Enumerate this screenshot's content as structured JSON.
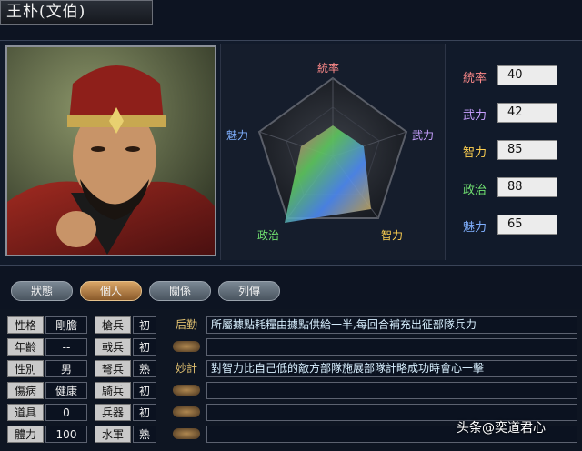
{
  "header": {
    "title": "王朴(文伯)"
  },
  "radar": {
    "labels": {
      "top": "統率",
      "right": "武力",
      "bottom_right": "智力",
      "bottom_left": "政治",
      "left": "魅力"
    },
    "label_colors": {
      "top": "#ff8a8a",
      "right": "#c8a0ff",
      "bottom_right": "#ffd050",
      "bottom_left": "#70e070",
      "left": "#80b0ff"
    }
  },
  "stats": [
    {
      "label": "統率",
      "value": "40",
      "color": "#ff8a8a"
    },
    {
      "label": "武力",
      "value": "42",
      "color": "#c8a0ff"
    },
    {
      "label": "智力",
      "value": "85",
      "color": "#ffd050"
    },
    {
      "label": "政治",
      "value": "88",
      "color": "#70e070"
    },
    {
      "label": "魅力",
      "value": "65",
      "color": "#80b0ff"
    }
  ],
  "tabs": [
    {
      "label": "狀態",
      "active": false
    },
    {
      "label": "個人",
      "active": true
    },
    {
      "label": "關係",
      "active": false
    },
    {
      "label": "列傳",
      "active": false
    }
  ],
  "personal": [
    {
      "label": "性格",
      "value": "剛膽"
    },
    {
      "label": "年齡",
      "value": "--"
    },
    {
      "label": "性別",
      "value": "男"
    },
    {
      "label": "傷病",
      "value": "健康"
    },
    {
      "label": "道具",
      "value": "0"
    },
    {
      "label": "體力",
      "value": "100"
    }
  ],
  "troops": [
    {
      "label": "槍兵",
      "value": "初"
    },
    {
      "label": "戟兵",
      "value": "初"
    },
    {
      "label": "弩兵",
      "value": "熟"
    },
    {
      "label": "騎兵",
      "value": "初"
    },
    {
      "label": "兵器",
      "value": "初"
    },
    {
      "label": "水軍",
      "value": "熟"
    }
  ],
  "skills": [
    {
      "name": "后勤",
      "desc": "所屬據點耗糧由據點供給一半,每回合補充出征部隊兵力"
    },
    {
      "name": "",
      "desc": ""
    },
    {
      "name": "妙計",
      "desc": "對智力比自己低的敵方部隊施展部隊計略成功時會心一擊"
    },
    {
      "name": "",
      "desc": ""
    },
    {
      "name": "",
      "desc": ""
    },
    {
      "name": "",
      "desc": ""
    }
  ],
  "watermark": "头条@奕道君心"
}
